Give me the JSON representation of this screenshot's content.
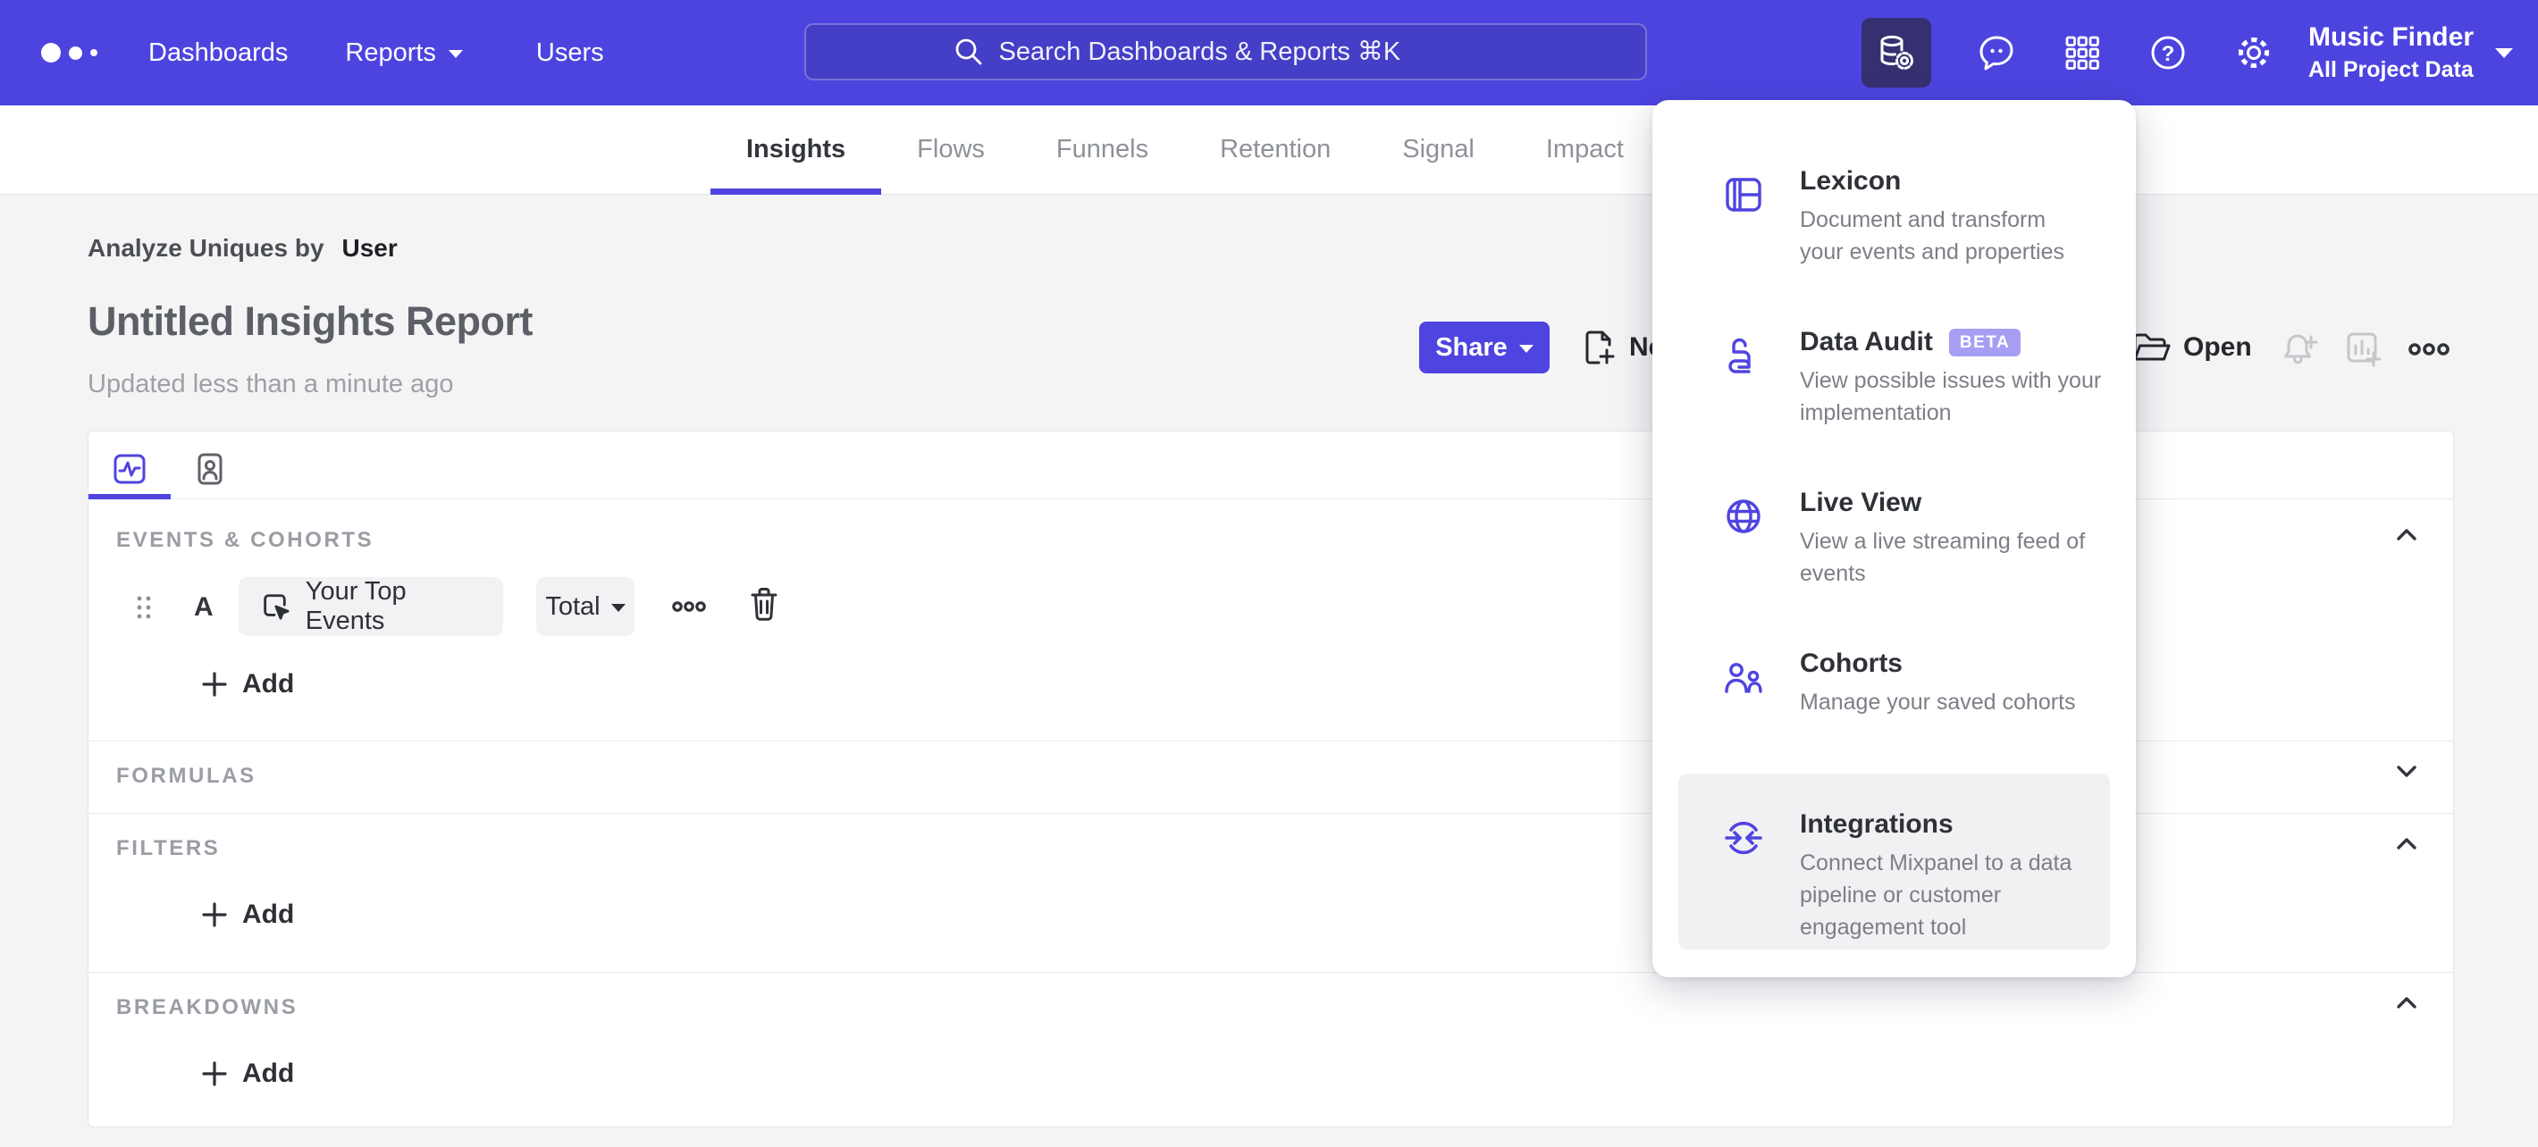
{
  "colors": {
    "nav_purple": "#4d44e0",
    "search_fill": "#453ec6",
    "active_tile": "#353070",
    "accent_purple": "#4f44e0",
    "page_bg": "#f4f4f5",
    "beta_badge_bg": "#a69ef2",
    "muted_icon": "#c4c6ca"
  },
  "topnav": {
    "items": [
      "Dashboards",
      "Reports",
      "Users"
    ],
    "search_placeholder": "Search Dashboards & Reports ⌘K",
    "project_name": "Music Finder",
    "project_scope": "All Project Data",
    "right_icons": [
      "data-management-icon",
      "feedback-bubble-icon",
      "apps-grid-icon",
      "help-icon",
      "settings-gear-icon"
    ]
  },
  "tabs": [
    {
      "label": "Insights",
      "active": true
    },
    {
      "label": "Flows",
      "active": false
    },
    {
      "label": "Funnels",
      "active": false
    },
    {
      "label": "Retention",
      "active": false
    },
    {
      "label": "Signal",
      "active": false
    },
    {
      "label": "Impact",
      "active": false
    }
  ],
  "report": {
    "analyze_label": "Analyze Uniques by",
    "analyze_value": "User",
    "title": "Untitled Insights Report",
    "updated": "Updated less than a minute ago"
  },
  "toolbar": {
    "share_label": "Share",
    "new_label": "New",
    "open_label": "Open"
  },
  "builder": {
    "events_header": "EVENTS & COHORTS",
    "row_letter": "A",
    "event_label": "Your Top Events",
    "measure_label": "Total",
    "add_label": "Add",
    "formulas_header": "FORMULAS",
    "filters_header": "FILTERS",
    "breakdowns_header": "BREAKDOWNS"
  },
  "menu": {
    "items": [
      {
        "icon": "lexicon-book-icon",
        "title": "Lexicon",
        "desc": "Document and transform\nyour events and properties"
      },
      {
        "icon": "data-audit-lock-icon",
        "title": "Data Audit",
        "badge": "BETA",
        "desc": "View possible issues with your\nimplementation"
      },
      {
        "icon": "live-view-globe-icon",
        "title": "Live View",
        "desc": "View a live streaming feed of\nevents"
      },
      {
        "icon": "cohorts-people-icon",
        "title": "Cohorts",
        "desc": "Manage your saved cohorts"
      },
      {
        "icon": "integrations-sync-icon",
        "title": "Integrations",
        "desc": "Connect Mixpanel to a data\npipeline or customer\nengagement tool"
      }
    ]
  }
}
